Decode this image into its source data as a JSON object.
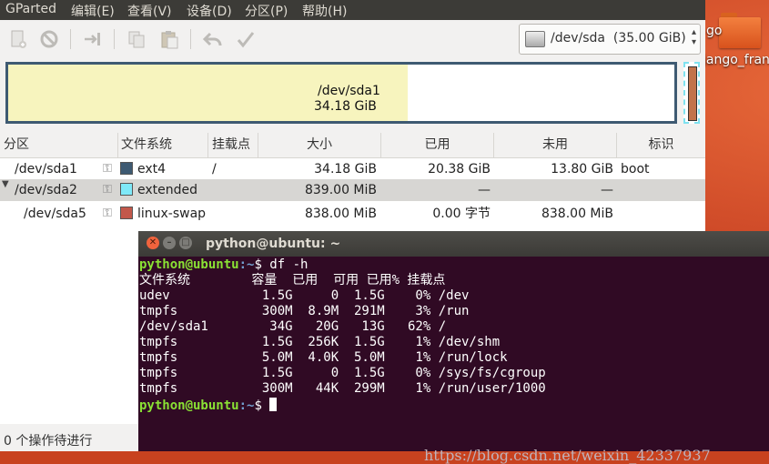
{
  "menubar": {
    "app": "GParted",
    "items": [
      "编辑(E)",
      "查看(V)",
      "设备(D)",
      "分区(P)",
      "帮助(H)"
    ]
  },
  "toolbar": {
    "icons": [
      "new-icon",
      "delete-icon",
      "resize-move-icon",
      "copy-icon",
      "paste-icon",
      "undo-icon",
      "apply-icon"
    ],
    "device_path": "/dev/sda",
    "device_size": "(35.00 GiB)"
  },
  "disk_graphic": {
    "name": "/dev/sda1",
    "size": "34.18 GiB",
    "used_fraction": 0.6
  },
  "table": {
    "headers": [
      "分区",
      "文件系统",
      "挂载点",
      "大小",
      "已用",
      "未用",
      "标识"
    ],
    "rows": [
      {
        "partition": "/dev/sda1",
        "fs": "ext4",
        "fs_color": "#3e5a72",
        "mount": "/",
        "size": "34.18 GiB",
        "used": "20.38 GiB",
        "unused": "13.80 GiB",
        "flags": "boot"
      },
      {
        "partition": "/dev/sda2",
        "fs": "extended",
        "fs_color": "#7fe9f8",
        "mount": "",
        "size": "839.00 MiB",
        "used": "—",
        "unused": "—",
        "flags": ""
      },
      {
        "partition": "/dev/sda5",
        "fs": "linux-swap",
        "fs_color": "#c2584b",
        "mount": "",
        "size": "838.00 MiB",
        "used": "0.00 字节",
        "unused": "838.00 MiB",
        "flags": ""
      }
    ]
  },
  "status": "0 个操作待进行",
  "desktop": {
    "folder_label_top": "go",
    "folder_label": "jango_fran"
  },
  "terminal": {
    "title": "python@ubuntu: ~",
    "prompt_user": "python@ubuntu",
    "prompt_path": ":~",
    "prompt_sym": "$",
    "command": " df -h",
    "output_lines": [
      "文件系统        容量  已用  可用 已用% 挂载点",
      "udev            1.5G     0  1.5G    0% /dev",
      "tmpfs           300M  8.9M  291M    3% /run",
      "/dev/sda1        34G   20G   13G   62% /",
      "tmpfs           1.5G  256K  1.5G    1% /dev/shm",
      "tmpfs           5.0M  4.0K  5.0M    1% /run/lock",
      "tmpfs           1.5G     0  1.5G    0% /sys/fs/cgroup",
      "tmpfs           300M   44K  299M    1% /run/user/1000"
    ],
    "watermark": "https://blog.csdn.net/weixin_42337937"
  }
}
